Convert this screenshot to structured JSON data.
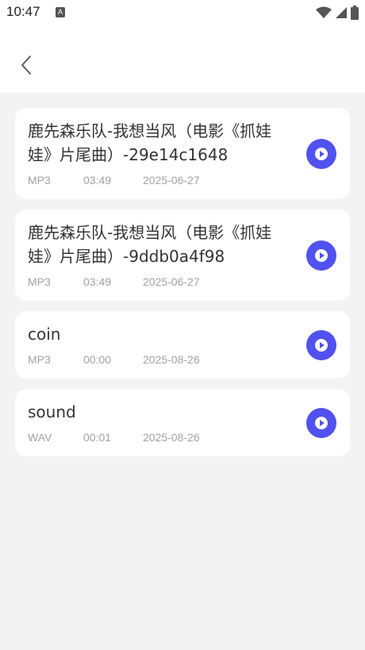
{
  "status_bar": {
    "time": "10:47",
    "notification_icon": "a-badge-icon",
    "icons": [
      "wifi-icon",
      "signal-icon",
      "battery-icon"
    ]
  },
  "header": {
    "back_icon": "chevron-left-icon"
  },
  "colors": {
    "accent": "#5151f0",
    "background": "#f3f3f3",
    "card": "#ffffff"
  },
  "files": [
    {
      "title": "鹿先森乐队-我想当风（电影《抓娃娃》片尾曲）-29e14c1648",
      "format": "MP3",
      "duration": "03:49",
      "date": "2025-06-27"
    },
    {
      "title": "鹿先森乐队-我想当风（电影《抓娃娃》片尾曲）-9ddb0a4f98",
      "format": "MP3",
      "duration": "03:49",
      "date": "2025-06-27"
    },
    {
      "title": "coin",
      "format": "MP3",
      "duration": "00:00",
      "date": "2025-08-26"
    },
    {
      "title": "sound",
      "format": "WAV",
      "duration": "00:01",
      "date": "2025-08-26"
    }
  ]
}
